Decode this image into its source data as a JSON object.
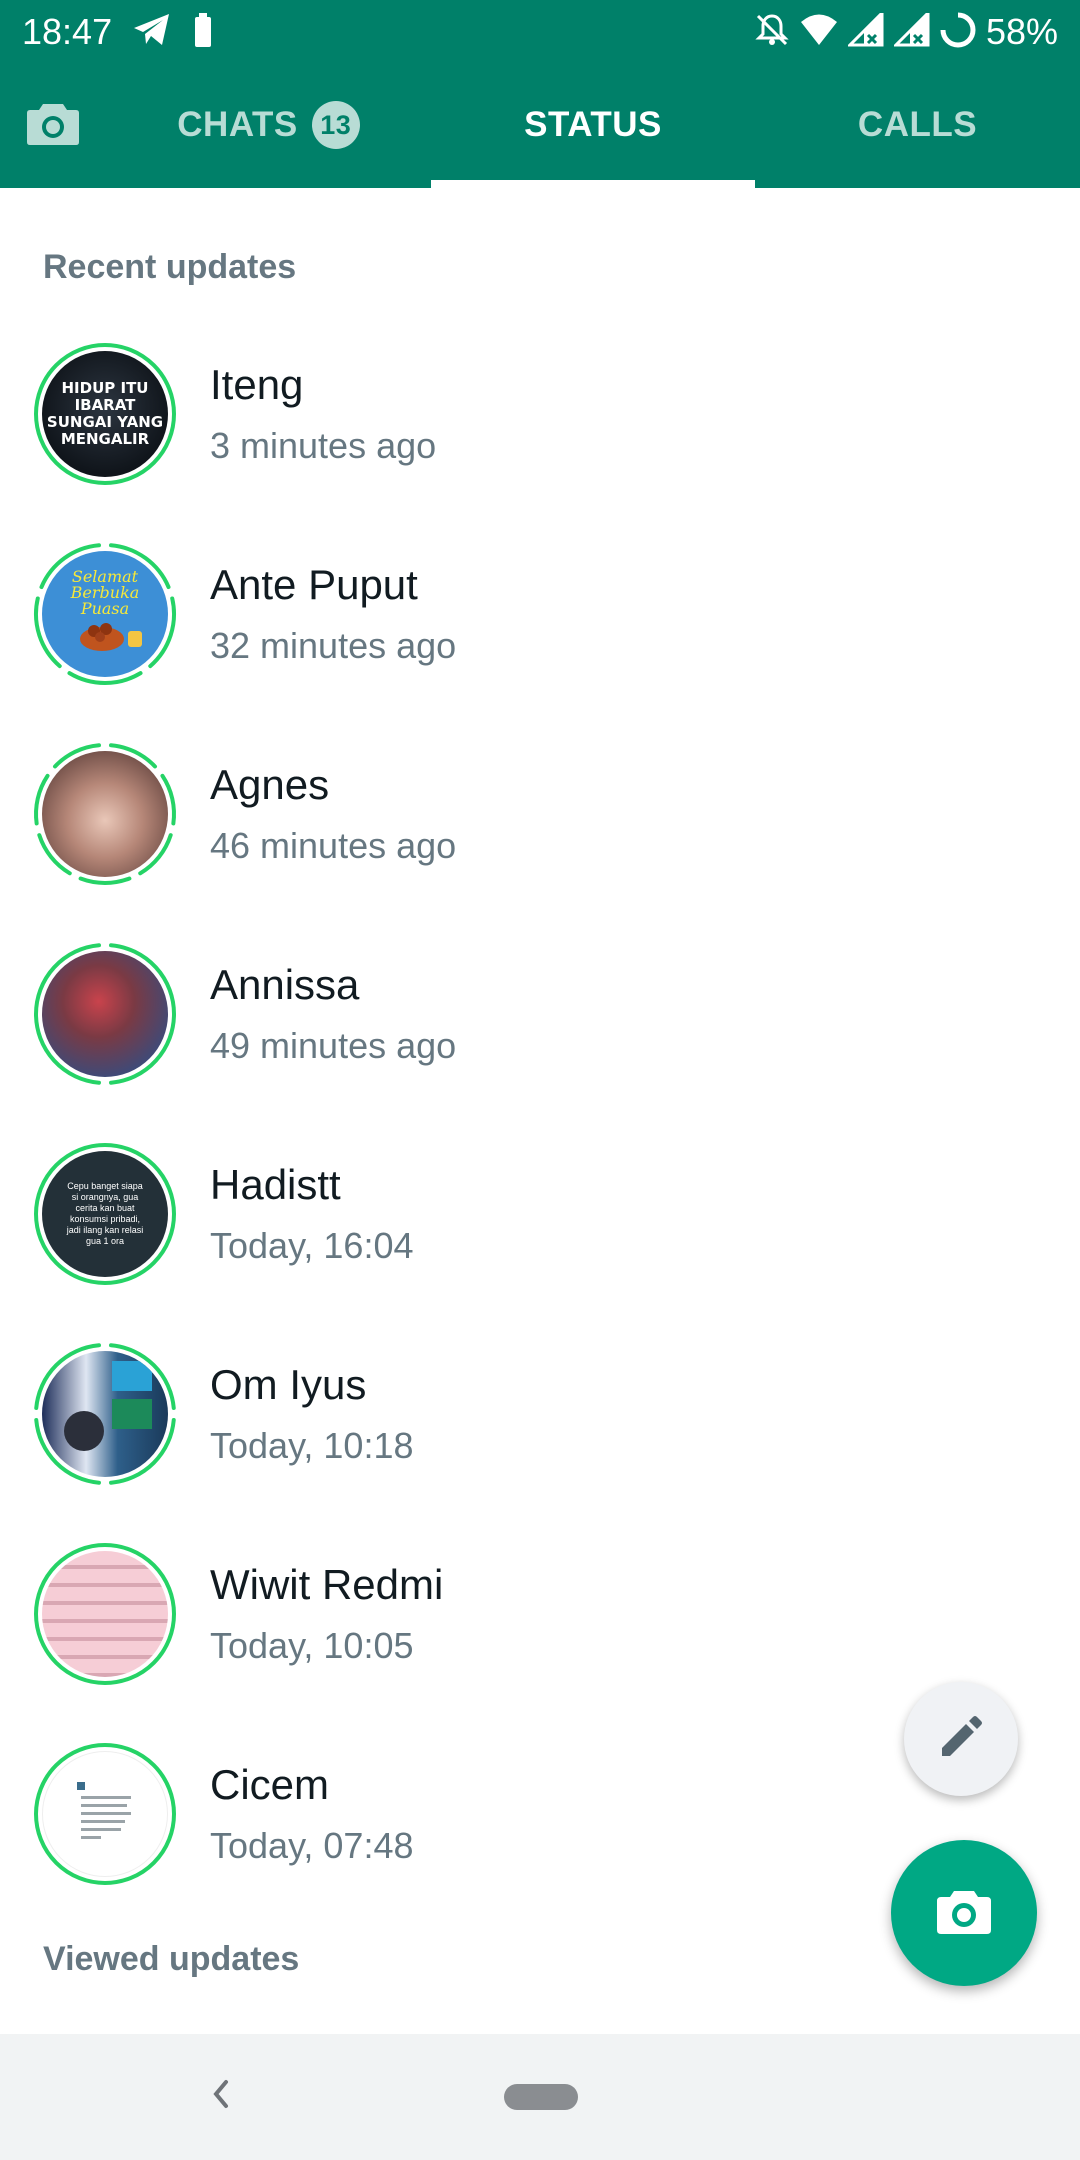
{
  "status_bar": {
    "time": "18:47",
    "battery": "58%",
    "icons": [
      "telegram-icon",
      "battery-saver-icon",
      "notifications-off-icon",
      "wifi-icon",
      "signal-icon",
      "signal-icon",
      "loading-ring-icon"
    ]
  },
  "tabs": {
    "camera_icon": "camera-icon",
    "items": [
      {
        "label": "CHATS",
        "badge": "13",
        "active": false
      },
      {
        "label": "STATUS",
        "active": true
      },
      {
        "label": "CALLS",
        "active": false
      }
    ]
  },
  "sections": {
    "recent": "Recent updates",
    "viewed": "Viewed updates"
  },
  "statuses": [
    {
      "name": "Iteng",
      "time": "3 minutes ago",
      "segments": 1,
      "thumb_lines": [
        "HIDUP ITU",
        "IBARAT",
        "SUNGAI YANG",
        "MENGALIR"
      ]
    },
    {
      "name": "Ante Puput",
      "time": "32 minutes ago",
      "segments": 5,
      "thumb_lines": [
        "Selamat",
        "Berbuka",
        "Puasa"
      ]
    },
    {
      "name": "Agnes",
      "time": "46 minutes ago",
      "segments": 7
    },
    {
      "name": "Annissa",
      "time": "49 minutes ago",
      "segments": 2
    },
    {
      "name": "Hadistt",
      "time": "Today, 16:04",
      "segments": 1,
      "thumb_lines": [
        "Cepu banget siapa",
        "si orangnya, gua",
        "cerita kan buat",
        "konsumsi pribadi,",
        "jadi ilang kan relasi",
        "gua 1 ora"
      ]
    },
    {
      "name": "Om Iyus",
      "time": "Today, 10:18",
      "segments": 4
    },
    {
      "name": "Wiwit Redmi",
      "time": "Today, 10:05",
      "segments": 1
    },
    {
      "name": "Cicem",
      "time": "Today, 07:48",
      "segments": 1
    }
  ],
  "fab": {
    "edit_icon": "pencil-icon",
    "camera_icon": "camera-icon"
  },
  "colors": {
    "header": "#008069",
    "accent": "#00a884",
    "ring": "#25d366",
    "secondary_text": "#667781",
    "primary_text": "#111b21"
  }
}
